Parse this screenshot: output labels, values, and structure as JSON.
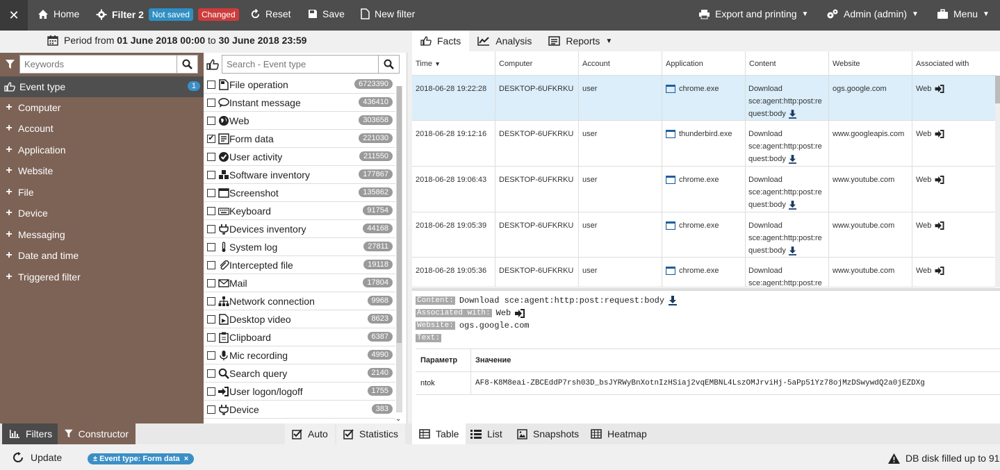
{
  "topbar": {
    "home": "Home",
    "filter_name": "Filter 2",
    "badge_not_saved": "Not saved",
    "badge_changed": "Changed",
    "reset": "Reset",
    "save": "Save",
    "new_filter": "New filter",
    "export": "Export and printing",
    "admin": "Admin (admin)",
    "menu": "Menu"
  },
  "period": {
    "prefix": "Period from",
    "from": "01 June 2018 00:00",
    "to_word": "to",
    "to": "30 June 2018 23:59"
  },
  "left": {
    "keywords_placeholder": "Keywords",
    "categories": [
      {
        "label": "Event type",
        "count": "1"
      },
      {
        "label": "Computer"
      },
      {
        "label": "Account"
      },
      {
        "label": "Application"
      },
      {
        "label": "Website"
      },
      {
        "label": "File"
      },
      {
        "label": "Device"
      },
      {
        "label": "Messaging"
      },
      {
        "label": "Date and time"
      },
      {
        "label": "Triggered filter"
      }
    ]
  },
  "middle": {
    "search_placeholder": "Search - Event type",
    "event_types": [
      {
        "label": "File operation",
        "count": "6723390",
        "checked": false,
        "icon": "file-icon"
      },
      {
        "label": "Instant message",
        "count": "436410",
        "checked": false,
        "icon": "chat-icon"
      },
      {
        "label": "Web",
        "count": "303658",
        "checked": false,
        "icon": "globe-icon"
      },
      {
        "label": "Form data",
        "count": "221030",
        "checked": true,
        "icon": "form-icon"
      },
      {
        "label": "User activity",
        "count": "211550",
        "checked": false,
        "icon": "check-circle-icon"
      },
      {
        "label": "Software inventory",
        "count": "177867",
        "checked": false,
        "icon": "boxes-icon"
      },
      {
        "label": "Screenshot",
        "count": "135862",
        "checked": false,
        "icon": "window-icon"
      },
      {
        "label": "Keyboard",
        "count": "91754",
        "checked": false,
        "icon": "keyboard-icon"
      },
      {
        "label": "Devices inventory",
        "count": "44168",
        "checked": false,
        "icon": "plug-icon"
      },
      {
        "label": "System log",
        "count": "27811",
        "checked": false,
        "icon": "thermometer-icon"
      },
      {
        "label": "Intercepted file",
        "count": "19118",
        "checked": false,
        "icon": "paperclip-icon"
      },
      {
        "label": "Mail",
        "count": "17804",
        "checked": false,
        "icon": "envelope-icon"
      },
      {
        "label": "Network connection",
        "count": "9968",
        "checked": false,
        "icon": "network-icon"
      },
      {
        "label": "Desktop video",
        "count": "8623",
        "checked": false,
        "icon": "video-icon"
      },
      {
        "label": "Clipboard",
        "count": "6387",
        "checked": false,
        "icon": "clipboard-icon"
      },
      {
        "label": "Mic recording",
        "count": "4990",
        "checked": false,
        "icon": "mic-icon"
      },
      {
        "label": "Search query",
        "count": "2140",
        "checked": false,
        "icon": "search-icon"
      },
      {
        "label": "User logon/logoff",
        "count": "1755",
        "checked": false,
        "icon": "logon-icon"
      },
      {
        "label": "Device",
        "count": "383",
        "checked": false,
        "icon": "plug-icon"
      }
    ]
  },
  "right": {
    "tabs": [
      "Facts",
      "Analysis",
      "Reports"
    ],
    "columns": [
      "Time",
      "Computer",
      "Account",
      "Application",
      "Content",
      "Website",
      "Associated with"
    ],
    "rows": [
      {
        "time": "2018-06-28 19:22:28",
        "computer": "DESKTOP-6UFKRKU",
        "account": "user",
        "app": "chrome.exe",
        "c1": "Download",
        "c2": "sce:agent:http:post:re",
        "c3": "quest:body",
        "site": "ogs.google.com",
        "assoc": "Web"
      },
      {
        "time": "2018-06-28 19:12:16",
        "computer": "DESKTOP-6UFKRKU",
        "account": "user",
        "app": "thunderbird.exe",
        "c1": "Download",
        "c2": "sce:agent:http:post:re",
        "c3": "quest:body",
        "site": "www.googleapis.com",
        "assoc": "Web"
      },
      {
        "time": "2018-06-28 19:06:43",
        "computer": "DESKTOP-6UFKRKU",
        "account": "user",
        "app": "chrome.exe",
        "c1": "Download",
        "c2": "sce:agent:http:post:re",
        "c3": "quest:body",
        "site": "www.youtube.com",
        "assoc": "Web"
      },
      {
        "time": "2018-06-28 19:05:39",
        "computer": "DESKTOP-6UFKRKU",
        "account": "user",
        "app": "chrome.exe",
        "c1": "Download",
        "c2": "sce:agent:http:post:re",
        "c3": "quest:body",
        "site": "www.youtube.com",
        "assoc": "Web"
      },
      {
        "time": "2018-06-28 19:05:36",
        "computer": "DESKTOP-6UFKRKU",
        "account": "user",
        "app": "chrome.exe",
        "c1": "Download",
        "c2": "sce:agent:http:post:re",
        "c3": "",
        "site": "www.youtube.com",
        "assoc": "Web"
      }
    ],
    "detail": {
      "content_label": "Content:",
      "content_value": "Download sce:agent:http:post:request:body",
      "assoc_label": "Associated with:",
      "assoc_value": "Web",
      "website_label": "Website:",
      "website_value": "ogs.google.com",
      "text_label": "Text:",
      "param_header": "Параметр",
      "value_header": "Значение",
      "param_name": "ntok",
      "param_value": "AF8-K8M8eai-ZBCEddP7rsh03D_bsJYRWyBnXotnIzHSiaj2vqEMBNL4LszOMJrviHj-5aPp51Yz78ojMzDSwywdQ2a0jEZDXg"
    }
  },
  "bottom": {
    "filters": "Filters",
    "constructor": "Constructor",
    "auto": "Auto",
    "statistics": "Statistics",
    "table": "Table",
    "list": "List",
    "snapshots": "Snapshots",
    "heatmap": "Heatmap",
    "update": "Update",
    "chip": "± Event type: Form data",
    "chip_close": "×",
    "disk_status": "DB disk filled up to 91%"
  }
}
